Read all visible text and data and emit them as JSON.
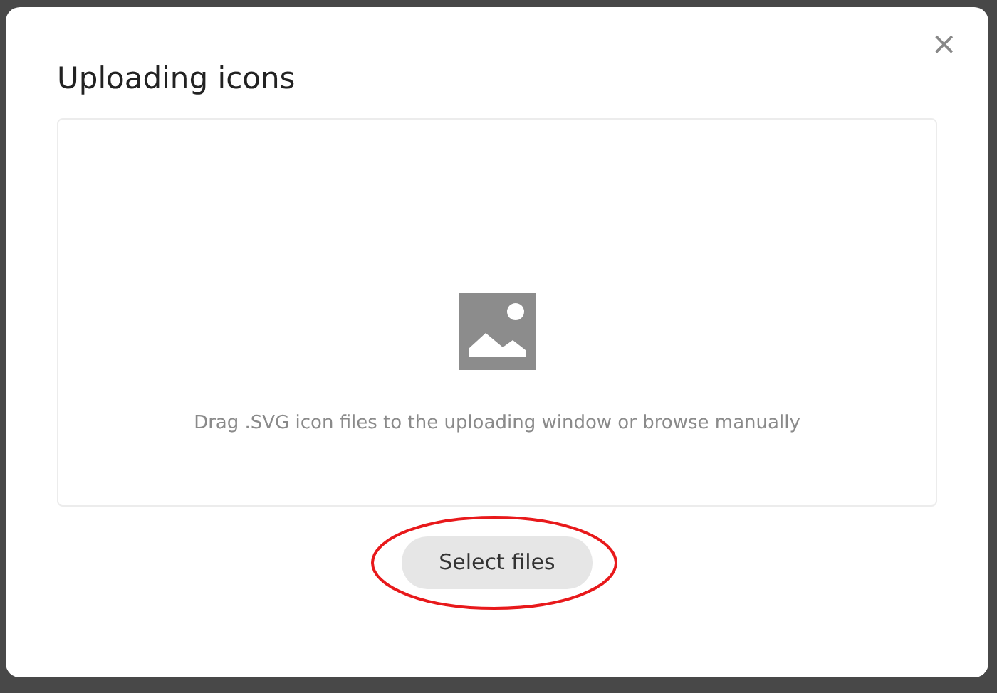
{
  "dialog": {
    "title": "Uploading icons",
    "close_label": "×",
    "drop_zone": {
      "hint": "Drag .SVG icon files to the uploading window or browse manually"
    },
    "button": {
      "label": "Select files",
      "highlighted": true
    }
  }
}
